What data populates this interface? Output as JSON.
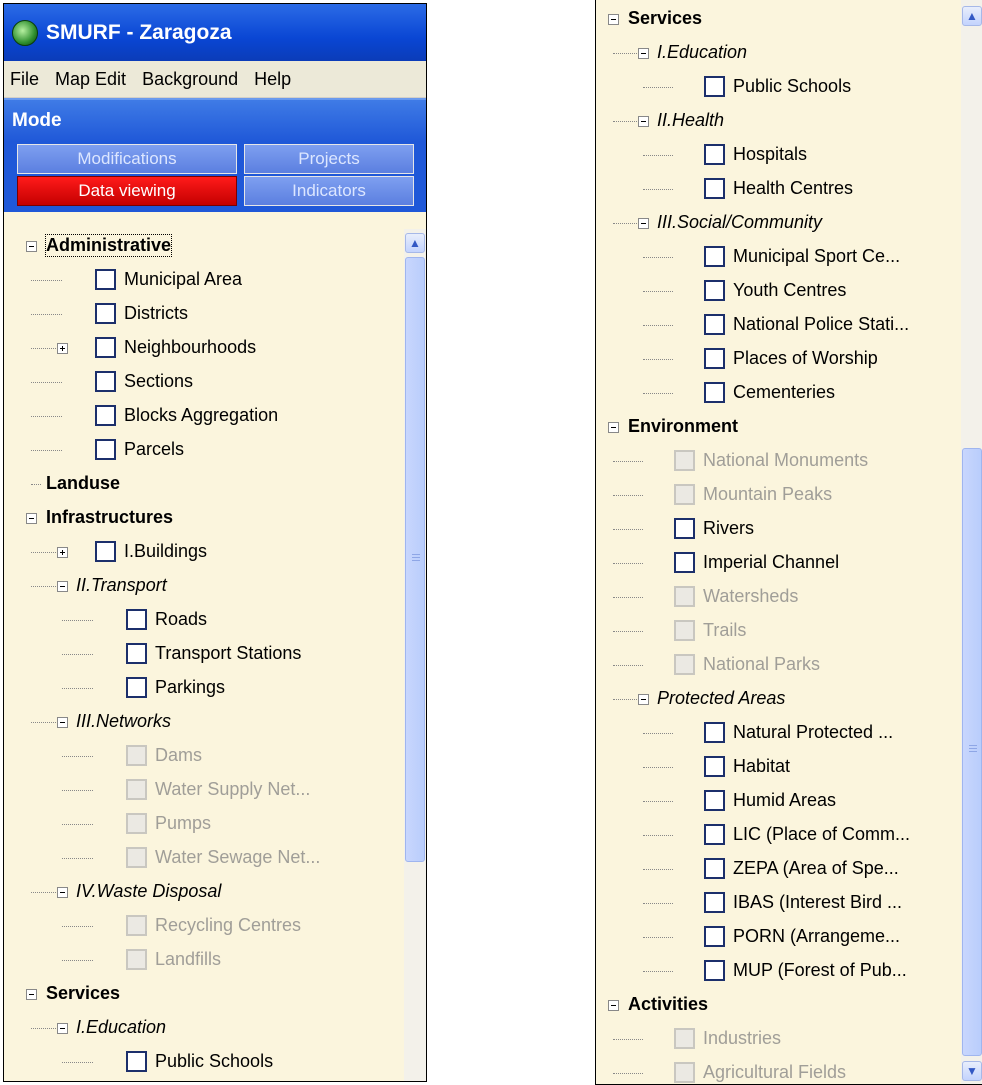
{
  "window": {
    "title": "SMURF - Zaragoza"
  },
  "menu": [
    "File",
    "Map Edit",
    "Background",
    "Help"
  ],
  "mode": {
    "header": "Mode",
    "tabs": [
      {
        "label": "Modifications",
        "active": false
      },
      {
        "label": "Projects",
        "active": false
      },
      {
        "label": "Data viewing",
        "active": true
      },
      {
        "label": "Indicators",
        "active": false
      }
    ]
  },
  "left_tree": [
    {
      "label": "Administrative",
      "level": 0,
      "style": "bold",
      "expander": "minus"
    },
    {
      "label": "Municipal Area",
      "level": 1,
      "checkbox": true
    },
    {
      "label": "Districts",
      "level": 1,
      "checkbox": true
    },
    {
      "label": "Neighbourhoods",
      "level": 1,
      "checkbox": true,
      "expander": "plus"
    },
    {
      "label": "Sections",
      "level": 1,
      "checkbox": true
    },
    {
      "label": "Blocks Aggregation",
      "level": 1,
      "checkbox": true
    },
    {
      "label": "Parcels",
      "level": 1,
      "checkbox": true
    },
    {
      "label": "Landuse",
      "level": 0,
      "style": "bold"
    },
    {
      "label": "Infrastructures",
      "level": 0,
      "style": "bold",
      "expander": "minus"
    },
    {
      "label": "I.Buildings",
      "level": 1,
      "checkbox": true,
      "expander": "plus"
    },
    {
      "label": "II.Transport",
      "level": 1,
      "style": "italic",
      "expander": "minus"
    },
    {
      "label": "Roads",
      "level": 2,
      "checkbox": true
    },
    {
      "label": "Transport Stations",
      "level": 2,
      "checkbox": true
    },
    {
      "label": "Parkings",
      "level": 2,
      "checkbox": true
    },
    {
      "label": "III.Networks",
      "level": 1,
      "style": "italic",
      "expander": "minus"
    },
    {
      "label": "Dams",
      "level": 2,
      "checkbox": true,
      "disabled": true
    },
    {
      "label": "Water Supply Net...",
      "level": 2,
      "checkbox": true,
      "disabled": true
    },
    {
      "label": "Pumps",
      "level": 2,
      "checkbox": true,
      "disabled": true
    },
    {
      "label": "Water Sewage Net...",
      "level": 2,
      "checkbox": true,
      "disabled": true
    },
    {
      "label": "IV.Waste Disposal",
      "level": 1,
      "style": "italic",
      "expander": "minus"
    },
    {
      "label": "Recycling Centres",
      "level": 2,
      "checkbox": true,
      "disabled": true
    },
    {
      "label": "Landfills",
      "level": 2,
      "checkbox": true,
      "disabled": true
    },
    {
      "label": "Services",
      "level": 0,
      "style": "bold",
      "expander": "minus"
    },
    {
      "label": "I.Education",
      "level": 1,
      "style": "italic",
      "expander": "minus"
    },
    {
      "label": "Public Schools",
      "level": 2,
      "checkbox": true
    }
  ],
  "right_tree": [
    {
      "label": "Services",
      "level": 0,
      "style": "bold",
      "expander": "minus"
    },
    {
      "label": "I.Education",
      "level": 1,
      "style": "italic",
      "expander": "minus"
    },
    {
      "label": "Public Schools",
      "level": 2,
      "checkbox": true
    },
    {
      "label": "II.Health",
      "level": 1,
      "style": "italic",
      "expander": "minus"
    },
    {
      "label": "Hospitals",
      "level": 2,
      "checkbox": true
    },
    {
      "label": "Health Centres",
      "level": 2,
      "checkbox": true
    },
    {
      "label": "III.Social/Community",
      "level": 1,
      "style": "italic",
      "expander": "minus"
    },
    {
      "label": "Municipal Sport Ce...",
      "level": 2,
      "checkbox": true
    },
    {
      "label": "Youth Centres",
      "level": 2,
      "checkbox": true
    },
    {
      "label": "National Police Stati...",
      "level": 2,
      "checkbox": true
    },
    {
      "label": "Places of Worship",
      "level": 2,
      "checkbox": true
    },
    {
      "label": "Cementeries",
      "level": 2,
      "checkbox": true
    },
    {
      "label": "Environment",
      "level": 0,
      "style": "bold",
      "expander": "minus"
    },
    {
      "label": "National Monuments",
      "level": 1,
      "checkbox": true,
      "disabled": true
    },
    {
      "label": "Mountain Peaks",
      "level": 1,
      "checkbox": true,
      "disabled": true
    },
    {
      "label": "Rivers",
      "level": 1,
      "checkbox": true
    },
    {
      "label": "Imperial Channel",
      "level": 1,
      "checkbox": true
    },
    {
      "label": "Watersheds",
      "level": 1,
      "checkbox": true,
      "disabled": true
    },
    {
      "label": "Trails",
      "level": 1,
      "checkbox": true,
      "disabled": true
    },
    {
      "label": "National Parks",
      "level": 1,
      "checkbox": true,
      "disabled": true
    },
    {
      "label": "Protected Areas",
      "level": 1,
      "style": "italic",
      "expander": "minus"
    },
    {
      "label": "Natural Protected ...",
      "level": 2,
      "checkbox": true
    },
    {
      "label": "Habitat",
      "level": 2,
      "checkbox": true
    },
    {
      "label": "Humid Areas",
      "level": 2,
      "checkbox": true
    },
    {
      "label": "LIC (Place of Comm...",
      "level": 2,
      "checkbox": true
    },
    {
      "label": "ZEPA (Area of Spe...",
      "level": 2,
      "checkbox": true
    },
    {
      "label": "IBAS (Interest Bird ...",
      "level": 2,
      "checkbox": true
    },
    {
      "label": "PORN (Arrangeme...",
      "level": 2,
      "checkbox": true
    },
    {
      "label": "MUP (Forest of Pub...",
      "level": 2,
      "checkbox": true
    },
    {
      "label": "Activities",
      "level": 0,
      "style": "bold",
      "expander": "minus"
    },
    {
      "label": "Industries",
      "level": 1,
      "checkbox": true,
      "disabled": true
    },
    {
      "label": "Agricultural Fields",
      "level": 1,
      "checkbox": true,
      "disabled": true
    }
  ],
  "colors": {
    "tree_bg": "#fbf5dd",
    "title_blue": "#0a46d4",
    "active_tab": "#c40000",
    "checkbox_border": "#1c2f6b"
  }
}
